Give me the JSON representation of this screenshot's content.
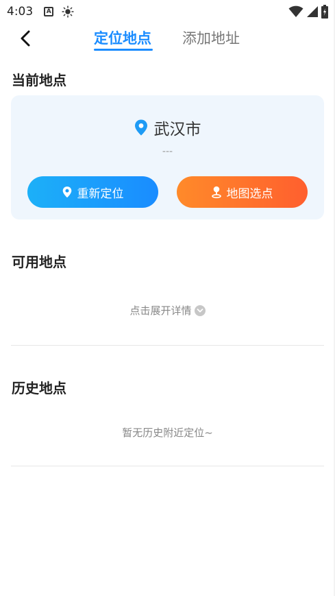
{
  "status_bar": {
    "time": "4:03",
    "notification_letter": "A"
  },
  "header": {
    "tabs": [
      {
        "label": "定位地点",
        "active": true
      },
      {
        "label": "添加地址",
        "active": false
      }
    ]
  },
  "current_location": {
    "title": "当前地点",
    "city": "武汉市",
    "detail": "---",
    "relocate_label": "重新定位",
    "map_pick_label": "地图选点"
  },
  "available_locations": {
    "title": "可用地点",
    "expand_hint": "点击展开详情"
  },
  "history_locations": {
    "title": "历史地点",
    "empty_hint": "暂无历史附近定位~"
  },
  "colors": {
    "accent": "#1a8cff",
    "orange": "#ff6a2c",
    "card_bg": "#eff6fd"
  },
  "icons": {
    "back": "chevron-left-icon",
    "location": "location-pin-icon",
    "map_pin": "map-pin-icon",
    "expand": "chevron-down-icon"
  }
}
